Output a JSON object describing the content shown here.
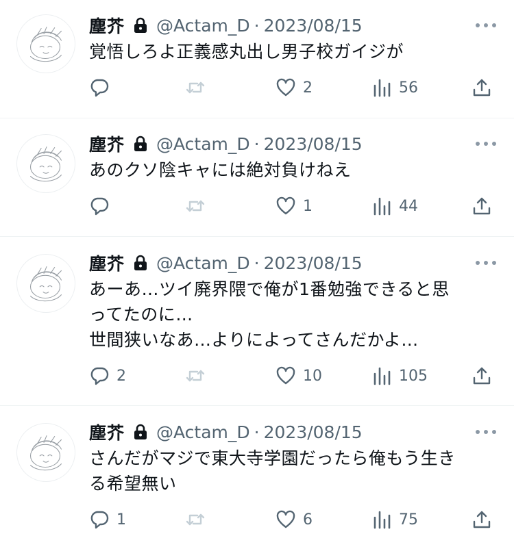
{
  "tweets": [
    {
      "name": "塵芥",
      "handle": "@Actam_D",
      "separator": "·",
      "date": "2023/08/15",
      "text": "覚悟しろよ正義感丸出し男子校ガイジが",
      "replies": "",
      "retweets": "",
      "likes": "2",
      "views": "56"
    },
    {
      "name": "塵芥",
      "handle": "@Actam_D",
      "separator": "·",
      "date": "2023/08/15",
      "text": "あのクソ陰キャには絶対負けねえ",
      "replies": "",
      "retweets": "",
      "likes": "1",
      "views": "44"
    },
    {
      "name": "塵芥",
      "handle": "@Actam_D",
      "separator": "·",
      "date": "2023/08/15",
      "text": "あーあ…ツイ廃界隈で俺が1番勉強できると思\nってたのに…\n世間狭いなあ…よりによってさんだかよ…",
      "replies": "2",
      "retweets": "",
      "likes": "10",
      "views": "105"
    },
    {
      "name": "塵芥",
      "handle": "@Actam_D",
      "separator": "·",
      "date": "2023/08/15",
      "text": "さんだがマジで東大寺学園だったら俺もう生き\nる希望無い",
      "replies": "1",
      "retweets": "",
      "likes": "6",
      "views": "75"
    }
  ],
  "icons": {
    "lock": "lock-icon",
    "more": "more-icon",
    "reply": "reply-icon",
    "retweet": "retweet-icon",
    "like": "heart-icon",
    "views": "views-icon",
    "share": "share-icon",
    "avatar": "avatar-icon"
  },
  "colors": {
    "text": "#0f1419",
    "secondary": "#536471",
    "muted": "#c4cfd6",
    "divider": "#eff3f4"
  }
}
